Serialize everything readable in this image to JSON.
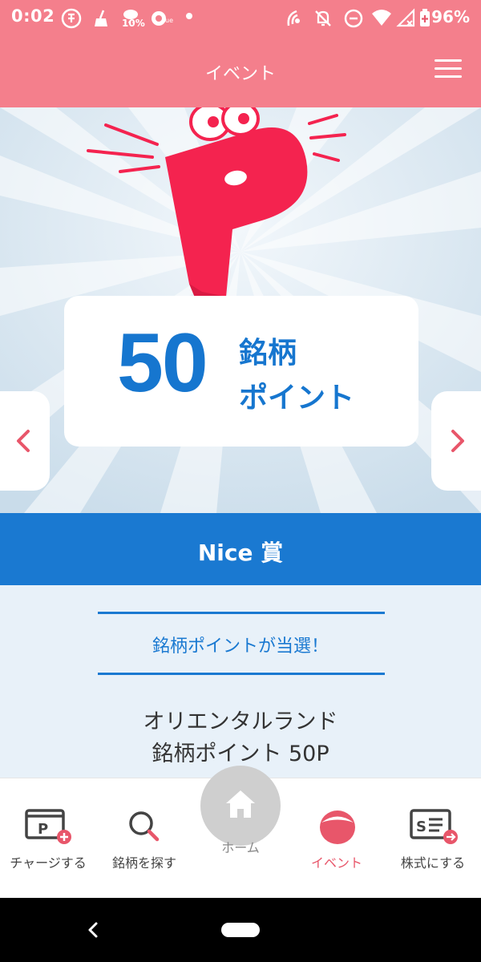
{
  "status_bar": {
    "time": "0:02",
    "weather_percent": "10%",
    "battery_percent": "96%"
  },
  "header": {
    "title": "イベント"
  },
  "banner": {
    "logo_letter": "P",
    "points_number": "50",
    "points_label_line1": "銘柄",
    "points_label_line2": "ポイント"
  },
  "prize": {
    "rank": "Nice 賞",
    "message": "銘柄ポイントが当選！",
    "reward_line1": "オリエンタルランド",
    "reward_line2": "銘柄ポイント 50P"
  },
  "bottom_nav": {
    "items": [
      {
        "label": "チャージする",
        "icon": "charge-icon"
      },
      {
        "label": "銘柄を探す",
        "icon": "search-icon"
      },
      {
        "label": "ホーム",
        "icon": "home-icon"
      },
      {
        "label": "イベント",
        "icon": "event-icon"
      },
      {
        "label": "株式にする",
        "icon": "stock-icon"
      }
    ]
  },
  "colors": {
    "header": "#f47f8c",
    "accent_blue": "#1a79d1",
    "active_pink": "#e8566a",
    "detail_background": "#e8f1f9"
  }
}
